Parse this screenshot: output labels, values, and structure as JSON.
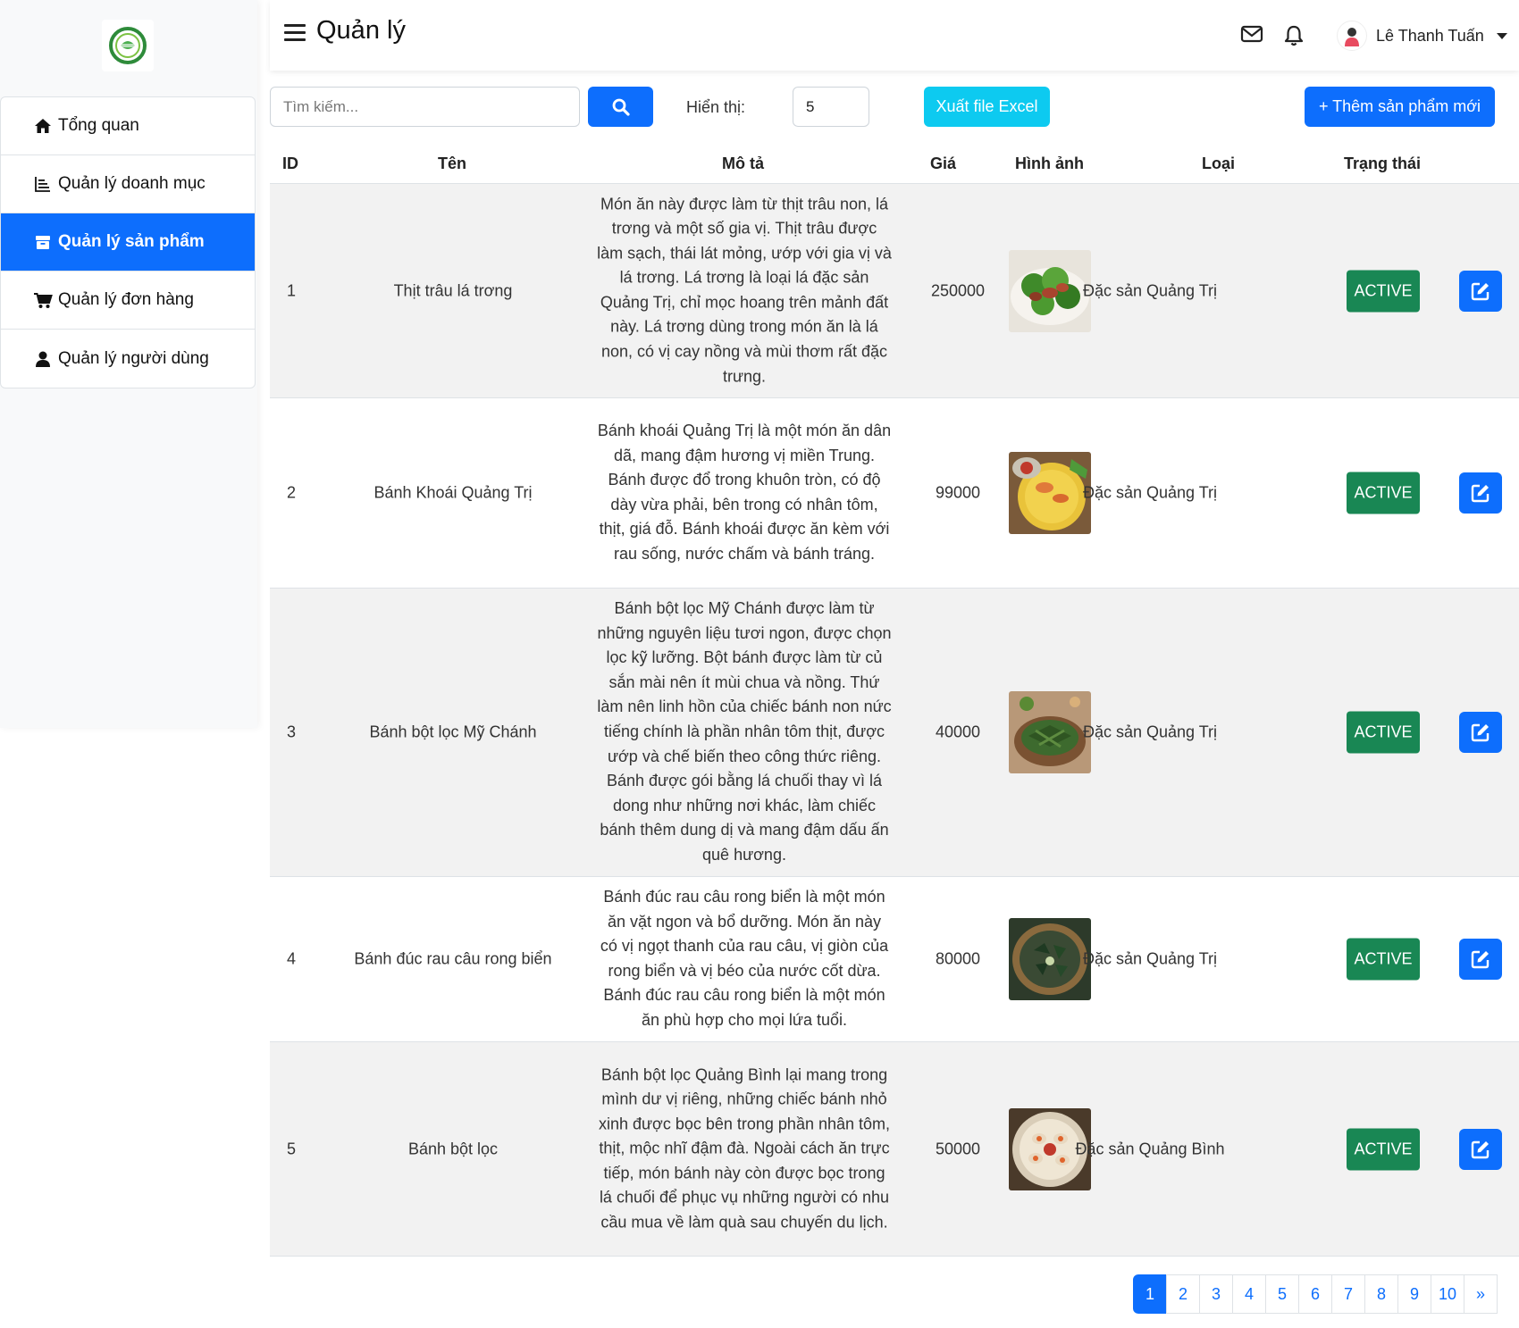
{
  "sidebar": {
    "items": [
      {
        "label": "Tổng quan",
        "icon": "home-icon"
      },
      {
        "label": "Quản lý doanh mục",
        "icon": "chart-icon"
      },
      {
        "label": "Quản lý sản phẩm",
        "icon": "box-icon"
      },
      {
        "label": "Quản lý đơn hàng",
        "icon": "cart-icon"
      },
      {
        "label": "Quản lý người dùng",
        "icon": "user-icon"
      }
    ],
    "active_index": 2
  },
  "header": {
    "title": "Quản lý",
    "user_name": "Lê Thanh Tuấn"
  },
  "toolbar": {
    "search_placeholder": "Tìm kiếm...",
    "show_label": "Hiển thị:",
    "show_value": "5",
    "excel_label": "Xuất file Excel",
    "add_label": "+ Thêm sản phẩm mới"
  },
  "table": {
    "headers": {
      "id": "ID",
      "name": "Tên",
      "description": "Mô tả",
      "price": "Giá",
      "image": "Hình ảnh",
      "category": "Loại",
      "status": "Trạng thái"
    },
    "rows": [
      {
        "id": "1",
        "name": "Thịt trâu lá trơng",
        "description": "Món ăn này được làm từ thịt trâu non, lá trơng và một số gia vị. Thịt trâu được làm sạch, thái lát mỏng, ướp với gia vị và lá trơng. Lá trơng là loại lá đặc sản Quảng Trị, chỉ mọc hoang trên mảnh đất này. Lá trơng dùng trong món ăn là lá non, có vị cay nồng và mùi thơm rất đặc trưng.",
        "price": "250000",
        "category": "Đặc sản Quảng Trị",
        "status": "ACTIVE"
      },
      {
        "id": "2",
        "name": "Bánh Khoái Quảng Trị",
        "description": "Bánh khoái Quảng Trị là một món ăn dân dã, mang đậm hương vị miền Trung. Bánh được đổ trong khuôn tròn, có độ dày vừa phải, bên trong có nhân tôm, thịt, giá đỗ. Bánh khoái được ăn kèm với rau sống, nước chấm và bánh tráng.",
        "price": "99000",
        "category": "Đặc sản Quảng Trị",
        "status": "ACTIVE"
      },
      {
        "id": "3",
        "name": "Bánh bột lọc Mỹ Chánh",
        "description": "Bánh bột lọc Mỹ Chánh được làm từ những nguyên liệu tươi ngon, được chọn lọc kỹ lưỡng. Bột bánh được làm từ củ sắn mài nên ít mùi chua và nồng. Thứ làm nên linh hồn của chiếc bánh non nức tiếng chính là phần nhân tôm thịt, được ướp và chế biến theo công thức riêng. Bánh được gói bằng lá chuối thay vì lá dong như những nơi khác, làm chiếc bánh thêm dung dị và mang đậm dấu ấn quê hương.",
        "price": "40000",
        "category": "Đặc sản Quảng Trị",
        "status": "ACTIVE"
      },
      {
        "id": "4",
        "name": "Bánh đúc rau câu rong biển",
        "description": "Bánh đúc rau câu rong biển là một món ăn vặt ngon và bổ dưỡng. Món ăn này có vị ngọt thanh của rau câu, vị giòn của rong biển và vị béo của nước cốt dừa. Bánh đúc rau câu rong biển là một món ăn phù hợp cho mọi lứa tuổi.",
        "price": "80000",
        "category": "Đặc sản Quảng Trị",
        "status": "ACTIVE"
      },
      {
        "id": "5",
        "name": "Bánh bột lọc",
        "description": "Bánh bột lọc Quảng Bình lại mang trong mình dư vị riêng, những chiếc bánh nhỏ xinh được bọc bên trong phần nhân tôm, thịt, mộc nhĩ đậm đà. Ngoài cách ăn trực tiếp, món bánh này còn được bọc trong lá chuối để phục vụ những người có nhu cầu mua về làm quà sau chuyến du lịch.",
        "price": "50000",
        "category": "Đặc sản Quảng Bình",
        "status": "ACTIVE"
      }
    ]
  },
  "pagination": {
    "pages": [
      "1",
      "2",
      "3",
      "4",
      "5",
      "6",
      "7",
      "8",
      "9",
      "10"
    ],
    "current": "1",
    "next": "»"
  },
  "colors": {
    "primary": "#0d6efd",
    "info": "#0dcaf0",
    "success": "#198754"
  }
}
